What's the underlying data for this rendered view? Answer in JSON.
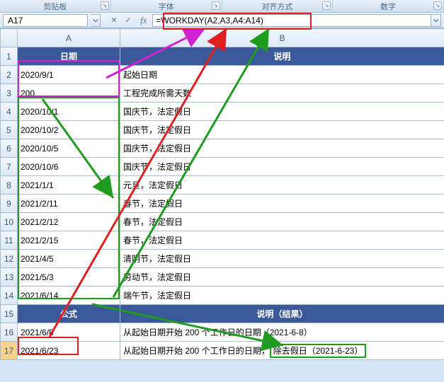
{
  "ribbon": {
    "groups": [
      "剪贴板",
      "字体",
      "对齐方式",
      "数字"
    ]
  },
  "namebox": {
    "value": "A17"
  },
  "formula": {
    "value": "=WORKDAY(A2,A3,A4:A14)"
  },
  "columns": [
    "A",
    "B"
  ],
  "headers": {
    "r1a": "日期",
    "r1b": "说明",
    "r15a": "公式",
    "r15b": "说明（结果）"
  },
  "rows": [
    {
      "a": "2020/9/1",
      "b": "起始日期"
    },
    {
      "a": "200",
      "b": "工程完成所需天数"
    },
    {
      "a": "2020/10/1",
      "b": "国庆节，法定假日"
    },
    {
      "a": "2020/10/2",
      "b": "国庆节，法定假日"
    },
    {
      "a": "2020/10/5",
      "b": "国庆节，法定假日"
    },
    {
      "a": "2020/10/6",
      "b": "国庆节，法定假日"
    },
    {
      "a": "2021/1/1",
      "b": "元旦，法定假日"
    },
    {
      "a": "2021/2/11",
      "b": "春节，法定假日"
    },
    {
      "a": "2021/2/12",
      "b": "春节，法定假日"
    },
    {
      "a": "2021/2/15",
      "b": "春节，法定假日"
    },
    {
      "a": "2021/4/5",
      "b": "清明节，法定假日"
    },
    {
      "a": "2021/5/3",
      "b": "劳动节，法定假日"
    },
    {
      "a": "2021/6/14",
      "b": "端午节，法定假日"
    }
  ],
  "results": {
    "r16a": "2021/6/8",
    "r16b": "从起始日期开始 200 个工作日的日期（2021-6-8）",
    "r17a": "2021/6/23",
    "r17b_prefix": "从起始日期开始 200 个工作日的日期，",
    "r17b_box": "除去假日（2021-6-23）"
  }
}
